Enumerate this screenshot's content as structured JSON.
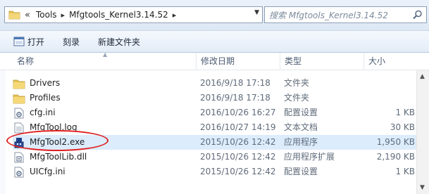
{
  "address": {
    "prefix": "«",
    "crumbs": [
      "Tools",
      "Mfgtools_Kernel3.14.52"
    ]
  },
  "search": {
    "placeholder": "搜索 Mfgtools_Kernel3.14.52"
  },
  "toolbar": {
    "open_label": "打开",
    "burn_label": "刻录",
    "new_folder_label": "新建文件夹"
  },
  "columns": {
    "name": "名称",
    "date": "修改日期",
    "type": "类型",
    "size": "大小"
  },
  "files": [
    {
      "name": "Drivers",
      "date": "2016/9/18 17:18",
      "type": "文件夹",
      "size": "",
      "icon": "folder-icon"
    },
    {
      "name": "Profiles",
      "date": "2016/9/18 17:18",
      "type": "文件夹",
      "size": "",
      "icon": "folder-icon"
    },
    {
      "name": "cfg.ini",
      "date": "2016/10/26 16:27",
      "type": "配置设置",
      "size": "1 KB",
      "icon": "config-file-icon"
    },
    {
      "name": "MfgTool.log",
      "date": "2016/10/27 14:19",
      "type": "文本文档",
      "size": "30 KB",
      "icon": "text-file-icon"
    },
    {
      "name": "MfgTool2.exe",
      "date": "2015/10/26 12:42",
      "type": "应用程序",
      "size": "1,950 KB",
      "icon": "application-icon"
    },
    {
      "name": "MfgToolLib.dll",
      "date": "2015/10/26 12:42",
      "type": "应用程序扩展",
      "size": "2,190 KB",
      "icon": "dll-file-icon"
    },
    {
      "name": "UICfg.ini",
      "date": "2015/10/26 12:42",
      "type": "配置设置",
      "size": "1 KB",
      "icon": "config-file-icon"
    }
  ],
  "colors": {
    "highlight_ring": "#e02020",
    "selection": "#dcecfc"
  }
}
